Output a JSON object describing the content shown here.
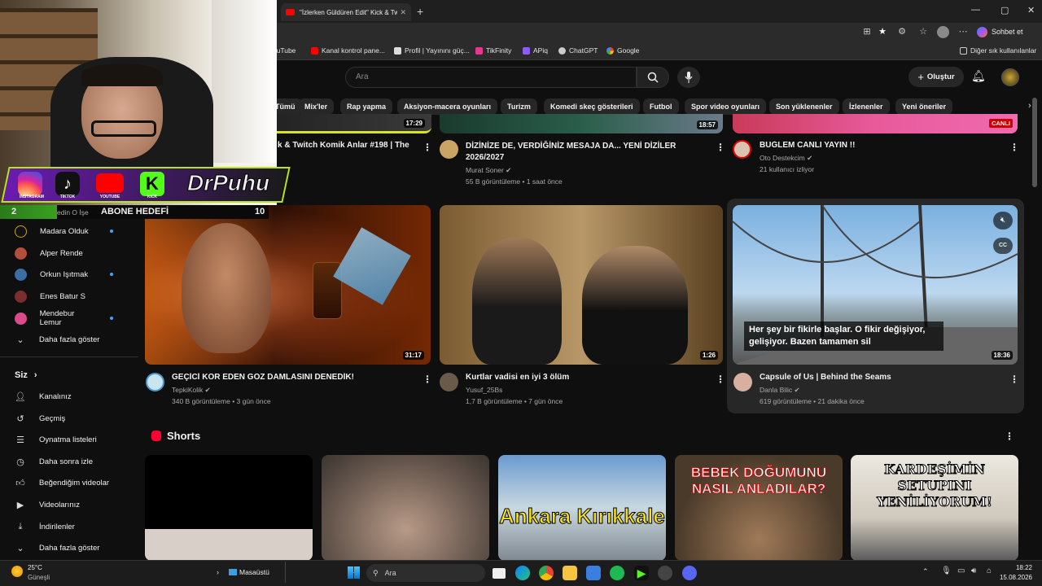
{
  "browser": {
    "tab_title": "\"İzlerken Güldüren Edit\" Kick & Tw",
    "bookmarks": [
      "YouTube",
      "Kanal kontrol pane...",
      "Profil | Yayınını güç...",
      "TikFinity",
      "APiq",
      "ChatGPT",
      "Google"
    ],
    "other_bookmarks": "Diğer sık kullanılanlar",
    "copilot_label": "Sohbet et"
  },
  "youtube": {
    "search_placeholder": "Ara",
    "create_label": "Oluştur",
    "chips": [
      "Tümü",
      "Mix'ler",
      "Rap yapma",
      "Aksiyon-macera oyunları",
      "Turizm",
      "Komedi skeç gösterileri",
      "Futbol",
      "Spor video oyunları",
      "Son yüklenenler",
      "İzlenenler",
      "Yeni öneriler"
    ],
    "sidebar_subs": [
      {
        "name": "Madara Olduk",
        "live": true
      },
      {
        "name": "Alper Rende",
        "live": false
      },
      {
        "name": "Orkun Işıtmak",
        "live": true
      },
      {
        "name": "Enes Batur S",
        "live": false
      },
      {
        "name": "Mendebur Lemur",
        "live": true
      }
    ],
    "sidebar_more1": "Daha fazla göster",
    "sidebar_you": "Siz",
    "sidebar_you_items": [
      "Kanalınız",
      "Geçmiş",
      "Oynatma listeleri",
      "Daha sonra izle",
      "Beğendiğim videolar",
      "Videolarınız",
      "İndirilenler",
      "Daha fazla göster"
    ],
    "top_row": [
      {
        "title": "k & Twitch Komik Anlar #198 | The",
        "channel": "",
        "meta": ""
      },
      {
        "title": "DİZİNİZE DE, VERDİĞİNİZ MESAJA DA... YENİ DİZİLER 2026/2027",
        "channel": "Murat Soner",
        "meta": "55 B görüntüleme • 1 saat önce",
        "duration": "18:57"
      },
      {
        "title": "BUĞLEM CANLI YAYIN !!",
        "channel": "Oto Destekcim",
        "meta": "21 kullanıcı izliyor",
        "badge": "CANLI"
      }
    ],
    "top_row_duration1": "17:29",
    "videos": [
      {
        "title": "GEÇİCİ KÖR EDEN GÖZ DAMLASINI DENEDİK!",
        "channel": "TepkiKolik",
        "meta": "340 B görüntüleme • 3 gün önce",
        "duration": "31:17"
      },
      {
        "title": "Kurtlar vadisi en iyi 3 ölüm",
        "channel": "Yusuf_25Bs",
        "meta": "1,7 B görüntüleme • 7 gün önce",
        "duration": "1:26"
      },
      {
        "title": "Capsule of Us | Behind the Seams",
        "channel": "Danla Bilic",
        "meta": "619 görüntüleme • 21 dakika önce",
        "duration": "18:36",
        "caption": "Her şey bir fikirle başlar. O fikir değişiyor, gelişiyor. Bazen tamamen sil"
      }
    ],
    "shorts_label": "Shorts",
    "shorts_texts": [
      "",
      "",
      "Ankara Kırıkkale",
      "BEBEK DOĞUMUNU NASIL ANLADILAR?",
      "KARDEŞİMİN SETUPINI YENİLİYORUM!"
    ]
  },
  "overlay": {
    "name": "DrPuhu",
    "socials": [
      "INSTAGRAM",
      "TIKTOK",
      "YOUTUBE",
      "KICK"
    ],
    "goal_current": "2",
    "goal_label": "ABONE HEDEFİ",
    "goal_target": "10",
    "goal_sub": "edin O İşe"
  },
  "taskbar": {
    "weather_temp": "25°C",
    "weather_desc": "Güneşli",
    "desktop_label": "Masaüstü",
    "search_label": "Ara",
    "time": "18:22",
    "date": "15.08.2026"
  },
  "colors": {
    "accent_red": "#ff0000",
    "live_blue": "#3ea6ff",
    "overlay_green": "#b5e61d",
    "overlay_purple": "#6a1bb0"
  }
}
